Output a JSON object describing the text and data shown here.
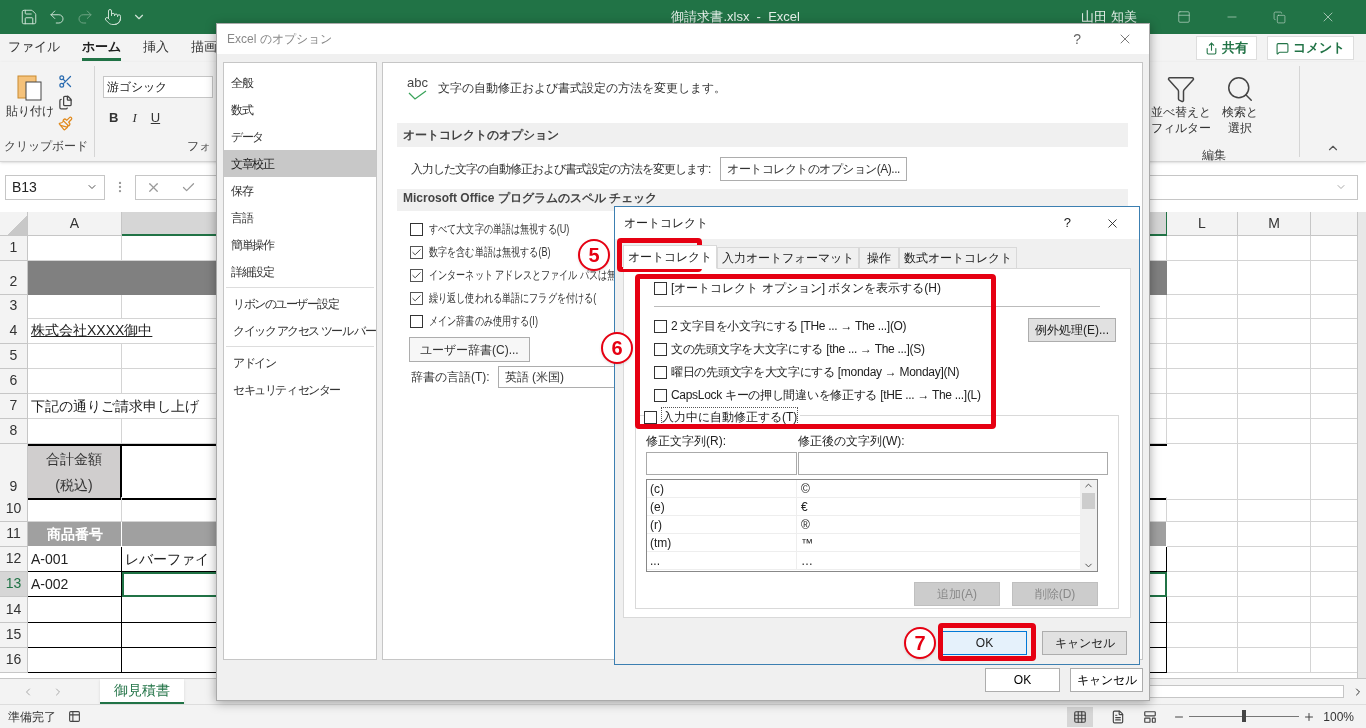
{
  "window": {
    "title": "御請求書.xlsx  -  Excel",
    "user": "山田 知美"
  },
  "ribbon_tabs": [
    {
      "label": "ファイル",
      "selected": false
    },
    {
      "label": "ホーム",
      "selected": true
    },
    {
      "label": "挿入",
      "selected": false
    },
    {
      "label": "描画",
      "selected": false
    }
  ],
  "share_button": "共有",
  "comment_button": "コメント",
  "ribbon": {
    "paste": "貼り付け",
    "clipboard_group": "クリップボード",
    "font_name": "游ゴシック",
    "font_group": "フォ",
    "bold": "B",
    "italic": "I",
    "underline": "U",
    "sort_filter": "並べ替えとフィルター",
    "find_select": "検索と選択",
    "edit_group": "編集"
  },
  "name_box": "B13",
  "columns": [
    "A",
    "L",
    "M"
  ],
  "rows": [
    {
      "number": "1",
      "selected": false,
      "cells": [
        {
          "kind": "plain"
        },
        {
          "kind": "plain"
        }
      ]
    },
    {
      "number": "2",
      "selected": false,
      "cells": [
        {
          "kind": "band"
        },
        {
          "kind": "band"
        }
      ]
    },
    {
      "number": "3",
      "selected": false,
      "cells": [
        {
          "kind": "plain"
        },
        {
          "kind": "plain"
        }
      ]
    },
    {
      "number": "4",
      "selected": false,
      "cells": [
        {
          "kind": "underlined",
          "text": "株式会社XXXX御中"
        },
        {
          "kind": "plain"
        }
      ]
    },
    {
      "number": "5",
      "selected": false,
      "cells": [
        {
          "kind": "plain"
        },
        {
          "kind": "plain"
        }
      ]
    },
    {
      "number": "6",
      "selected": false,
      "cells": [
        {
          "kind": "plain"
        },
        {
          "kind": "plain"
        }
      ]
    },
    {
      "number": "7",
      "selected": false,
      "cells": [
        {
          "kind": "plain",
          "text": "下記の通りご請求申し上げ"
        },
        {
          "kind": "plain"
        }
      ]
    },
    {
      "number": "8",
      "selected": false,
      "cells": [
        {
          "kind": "plain"
        },
        {
          "kind": "plain"
        }
      ]
    },
    {
      "number": "9",
      "selected": false,
      "cells": [
        {
          "kind": "total",
          "text": "合計金額\n(税込)"
        },
        {
          "kind": "total-value"
        }
      ]
    },
    {
      "number": "10",
      "selected": false,
      "cells": [
        {
          "kind": "plain"
        },
        {
          "kind": "plain"
        }
      ]
    },
    {
      "number": "11",
      "selected": false,
      "cells": [
        {
          "kind": "heading",
          "text": "商品番号"
        },
        {
          "kind": "heading"
        }
      ]
    },
    {
      "number": "12",
      "selected": false,
      "cells": [
        {
          "kind": "table",
          "text": "A-001"
        },
        {
          "kind": "table",
          "text": "レバーファイ"
        }
      ]
    },
    {
      "number": "13",
      "selected": true,
      "cells": [
        {
          "kind": "table",
          "text": "A-002"
        },
        {
          "kind": "table"
        }
      ]
    },
    {
      "number": "14",
      "selected": false,
      "cells": [
        {
          "kind": "table"
        },
        {
          "kind": "table"
        }
      ]
    },
    {
      "number": "15",
      "selected": false,
      "cells": [
        {
          "kind": "table"
        },
        {
          "kind": "table"
        }
      ]
    },
    {
      "number": "16",
      "selected": false,
      "cells": [
        {
          "kind": "table"
        },
        {
          "kind": "table"
        }
      ]
    }
  ],
  "sheet_tabs": [
    {
      "label": "御見積書",
      "selected": true
    }
  ],
  "status": "準備完了",
  "zoom": {
    "label": "100%",
    "level": 0.5
  },
  "options_dialog": {
    "title": "Excel のオプション",
    "help": "?",
    "nav_groups": [
      [
        {
          "label": "全般",
          "selected": false
        },
        {
          "label": "数式",
          "selected": false
        },
        {
          "label": "データ",
          "selected": false
        },
        {
          "label": "文章校正",
          "selected": true
        },
        {
          "label": "保存",
          "selected": false
        },
        {
          "label": "言語",
          "selected": false
        },
        {
          "label": "簡単操作",
          "selected": false
        },
        {
          "label": "詳細設定",
          "selected": false
        }
      ],
      [
        {
          "label": "リボンのユーザー設定",
          "selected": false
        },
        {
          "label": "クイック アクセス ツール バー",
          "selected": false
        }
      ],
      [
        {
          "label": "アドイン",
          "selected": false
        },
        {
          "label": "セキュリティ センター",
          "selected": false
        }
      ]
    ],
    "icon_label": "abc",
    "header": "文字の自動修正および書式設定の方法を変更します。",
    "autocorrect_section": "オートコレクトのオプション",
    "autocorrect_text": "入力した文字の自動修正および書式設定の方法を変更します:",
    "autocorrect_button": "オートコレクトのオプション(A)...",
    "spelling_section": "Microsoft Office プログラムのスペル チェック",
    "spelling_options": [
      {
        "label": "すべて大文字の単語は無視する(U)",
        "checked": false
      },
      {
        "label": "数字を含む単語は無視する(B)",
        "checked": true
      },
      {
        "label": "インターネット アドレスとファイル パスは無",
        "checked": true
      },
      {
        "label": "繰り返し使われる単語にフラグを付ける(",
        "checked": true
      },
      {
        "label": "メイン辞書のみ使用する(I)",
        "checked": false
      }
    ],
    "dictionary_button": "ユーザー辞書(C)...",
    "language_label": "辞書の言語(T):",
    "language_value": "英語 (米国)",
    "ok_button": "OK",
    "cancel_button": "キャンセル"
  },
  "autocorrect_dialog": {
    "title": "オートコレクト",
    "help": "?",
    "tabs": [
      {
        "label": "オートコレクト",
        "selected": true
      },
      {
        "label": "入力オートフォーマット",
        "selected": false
      },
      {
        "label": "操作",
        "selected": false
      },
      {
        "label": "数式オートコレクト",
        "selected": false
      }
    ],
    "show_buttons_option": {
      "label": "[オートコレクト オプション] ボタンを表示する(H)",
      "checked": false
    },
    "options": [
      {
        "label": "2 文字目を小文字にする [THe ... → The ...](O)",
        "checked": false
      },
      {
        "label": "文の先頭文字を大文字にする [the ... → The ...](S)",
        "checked": false
      },
      {
        "label": "曜日の先頭文字を大文字にする [monday → Monday](N)",
        "checked": false
      },
      {
        "label": "CapsLock キーの押し間違いを修正する [tHE ... → The ...](L)",
        "checked": false
      }
    ],
    "exceptions_button": "例外処理(E)...",
    "replace_as_you_type": {
      "label": "入力中に自動修正する(T)",
      "checked": false
    },
    "replace_label": "修正文字列(R):",
    "with_label": "修正後の文字列(W):",
    "entries": [
      {
        "replace": "(c)",
        "with": "©"
      },
      {
        "replace": "(e)",
        "with": "€"
      },
      {
        "replace": "(r)",
        "with": "®"
      },
      {
        "replace": "(tm)",
        "with": "™"
      },
      {
        "replace": "...",
        "with": "…"
      }
    ],
    "add_button": {
      "label": "追加(A)",
      "disabled": true
    },
    "delete_button": {
      "label": "削除(D)",
      "disabled": true
    },
    "ok_button": "OK",
    "cancel_button": "キャンセル"
  },
  "annotations": [
    {
      "label": "5"
    },
    {
      "label": "6"
    },
    {
      "label": "7"
    }
  ]
}
